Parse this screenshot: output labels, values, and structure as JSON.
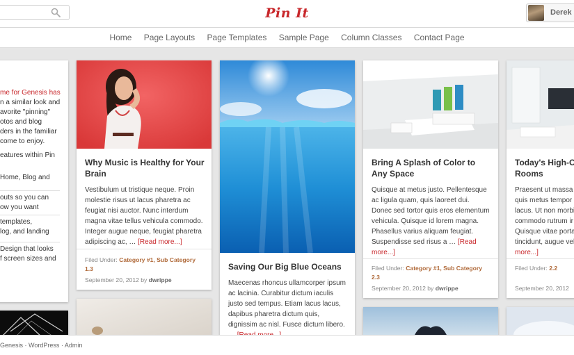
{
  "header": {
    "logo": "Pin It",
    "user": "Derek"
  },
  "nav": [
    "Home",
    "Page Layouts",
    "Page Templates",
    "Sample Page",
    "Column Classes",
    "Contact Page"
  ],
  "intro": {
    "lines": [
      "me for Genesis has",
      "n a similar look and",
      "avorite \"pinning\"",
      "otos and blog",
      "ders in the familiar",
      "come to enjoy.",
      "eatures within Pin",
      "Home, Blog and",
      "outs so you can",
      "ow you want",
      "templates,",
      "log, and landing",
      "Design that looks",
      "f screen sizes and"
    ]
  },
  "posts": [
    {
      "title": "Why Music is Healthy for Your Brain",
      "excerpt": "Vestibulum ut tristique neque. Proin molestie risus ut lacus pharetra ac feugiat nisi auctor. Nunc interdum magna vitae tellus vehicula commodo. Integer augue neque, feugiat pharetra adipiscing ac, …",
      "more": "[Read more...]",
      "filed_label": "Filed Under:",
      "categories": "Category #1, Sub Category 1.3",
      "date": "September 20, 2012",
      "by": "by",
      "author": "dwrippe"
    },
    {
      "title": "Saving Our Big Blue Oceans",
      "excerpt": "Maecenas rhoncus ullamcorper ipsum ac lacinia. Curabitur dictum iaculis justo sed tempus. Etiam lacus lacus, dapibus pharetra dictum quis, dignissim ac nisl. Fusce dictum libero. …",
      "more": "[Read more...]"
    },
    {
      "title": "Bring A Splash of Color to Any Space",
      "excerpt": "Quisque at metus justo. Pellentesque ac ligula quam, quis laoreet dui. Donec sed tortor quis eros elementum vehicula. Quisque id lorem magna. Phasellus varius aliquam feugiat. Suspendisse sed risus a …",
      "more": "[Read more...]",
      "filed_label": "Filed Under:",
      "categories": "Category #1, Sub Category 2.3",
      "date": "September 20, 2012",
      "by": "by",
      "author": "dwrippe"
    },
    {
      "title": "Today's High-Cl Rooms",
      "excerpt": "Praesent ut massa quis metus tempor lacus. Ut non morbi commodo rutrum ir Quisque vitae porta tincidunt, augue vel",
      "more": "more...]",
      "filed_label": "Filed Under:",
      "categories": "2.2",
      "date": "September 20, 2012"
    }
  ],
  "footer": {
    "text": "Genesis · WordPress · Admin"
  },
  "colors": {
    "accent": "#c8272b",
    "background": "#e6e6e6"
  }
}
